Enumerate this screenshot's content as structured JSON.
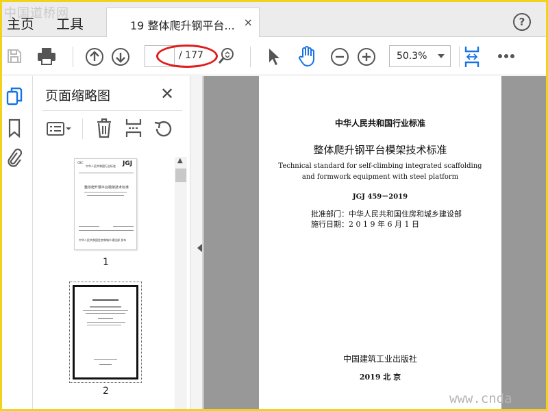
{
  "watermark_top": "中国道桥网",
  "watermark_bottom": "www.cnda",
  "nav": {
    "home": "主页",
    "tools": "工具"
  },
  "tab": {
    "title": "19 整体爬升钢平台...",
    "close": "×"
  },
  "help": "?",
  "toolbar": {
    "page_current": "",
    "page_total": "/ 177",
    "zoom": "50.3%"
  },
  "panel": {
    "title": "页面缩略图",
    "close": "✕",
    "thumbnails": [
      {
        "label": "1"
      },
      {
        "label": "2"
      }
    ]
  },
  "thumb1": {
    "corner": "CBC",
    "header": "中华人民共和国行业标准",
    "code": "JGJ",
    "title": "整体爬升钢平台模架技术标准",
    "footer": "中华人民共和国住房和城乡建设部 发布"
  },
  "document": {
    "header": "中华人民共和国行业标准",
    "title_cn": "整体爬升钢平台模架技术标准",
    "title_en_1": "Technical standard for self-climbing integrated scaffolding",
    "title_en_2": "and formwork equipment with steel platform",
    "code": "JGJ 459－2019",
    "approved_by": "批准部门：中华人民共和国住房和城乡建设部",
    "effective_date": "施行日期：2 0 1 9 年 6 月 1 日",
    "publisher": "中国建筑工业出版社",
    "year_city": "2019  北  京"
  },
  "colors": {
    "frame": "#f2d21b",
    "accent_blue": "#1473e6",
    "annotation_red": "#e01b1b",
    "canvas_gray": "#989898"
  },
  "icons": [
    "save-icon",
    "print-icon",
    "page-up-icon",
    "page-down-icon",
    "find-icon",
    "select-arrow-icon",
    "hand-icon",
    "zoom-out-icon",
    "zoom-in-icon",
    "fit-page-icon",
    "more-icon",
    "thumbnails-icon",
    "bookmark-icon",
    "attachment-icon",
    "options-icon",
    "delete-icon",
    "insert-page-icon",
    "rotate-icon"
  ]
}
